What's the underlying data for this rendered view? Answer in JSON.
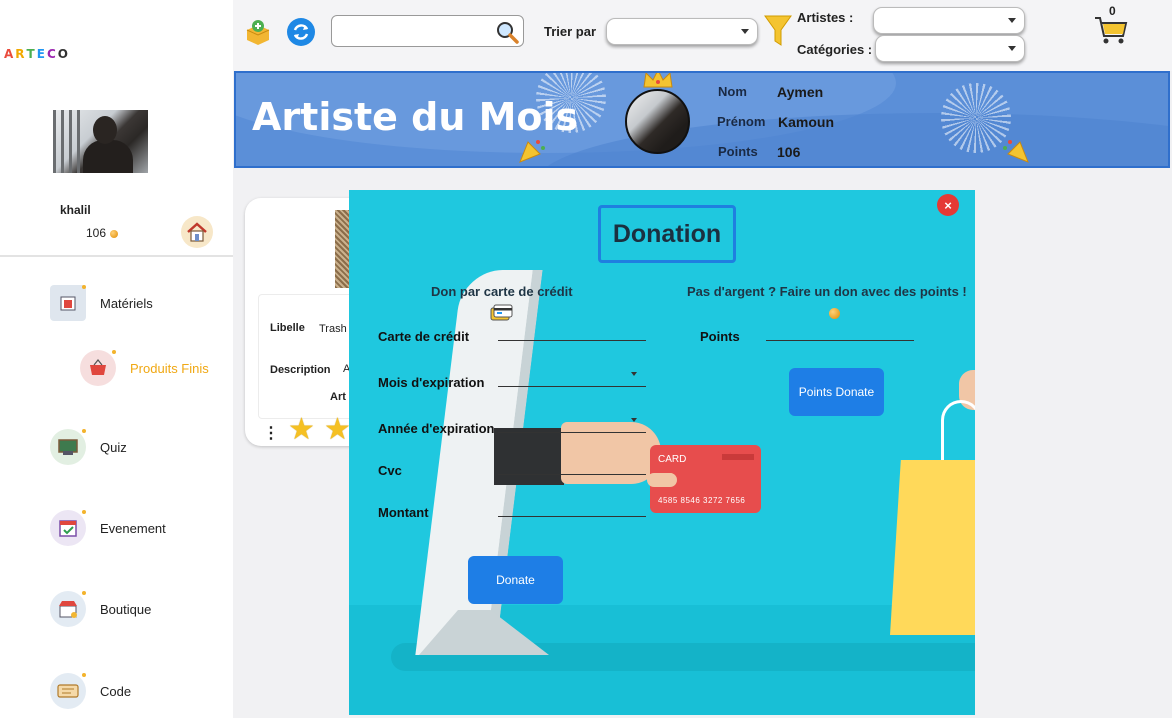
{
  "app": {
    "logo": "ARTECO"
  },
  "user": {
    "name": "khalil",
    "points": "106"
  },
  "sidebar": {
    "items": [
      {
        "label": "Matériels",
        "icon": "box-icon"
      },
      {
        "label": "Produits Finis",
        "icon": "shopping-basket-icon",
        "active": true
      },
      {
        "label": "Quiz",
        "icon": "quiz-board-icon"
      },
      {
        "label": "Evenement",
        "icon": "calendar-icon"
      },
      {
        "label": "Boutique",
        "icon": "shop-icon"
      },
      {
        "label": "Code",
        "icon": "ticket-icon"
      }
    ]
  },
  "toolbar": {
    "search_value": "",
    "sort_label": "Trier par",
    "sort_value": "",
    "artists_label": "Artistes :",
    "artists_value": "",
    "categories_label": "Catégories :",
    "categories_value": "",
    "cart_count": "0"
  },
  "banner": {
    "title": "Artiste du Mois",
    "nom_label": "Nom",
    "nom_value": "Aymen",
    "prenom_label": "Prénom",
    "prenom_value": "Kamoun",
    "points_label": "Points",
    "points_value": "106"
  },
  "product_card": {
    "libelle_label": "Libelle",
    "libelle_value": "Trash",
    "description_label": "Description",
    "description_value": "A",
    "artist_fragment": "Art"
  },
  "modal": {
    "title": "Donation",
    "close": "×",
    "card_section_title": "Don par carte de crédit",
    "points_section_title": "Pas d'argent ? Faire un don avec des points !",
    "fields": {
      "card_number": "Carte de crédit",
      "exp_month": "Mois d'expiration",
      "exp_year": "Année d'expiration",
      "cvc": "Cvc",
      "amount": "Montant",
      "points": "Points"
    },
    "donate_button": "Donate",
    "points_donate_button": "Points Donate",
    "illustration_card": {
      "label": "CARD",
      "number": "4585 8546 3272 7656"
    }
  },
  "colors": {
    "accent": "#1e7ee6",
    "banner": "#5b8fd8",
    "modal_bg": "#1fc8df",
    "active_nav": "#f0a814",
    "close": "#e53935"
  }
}
